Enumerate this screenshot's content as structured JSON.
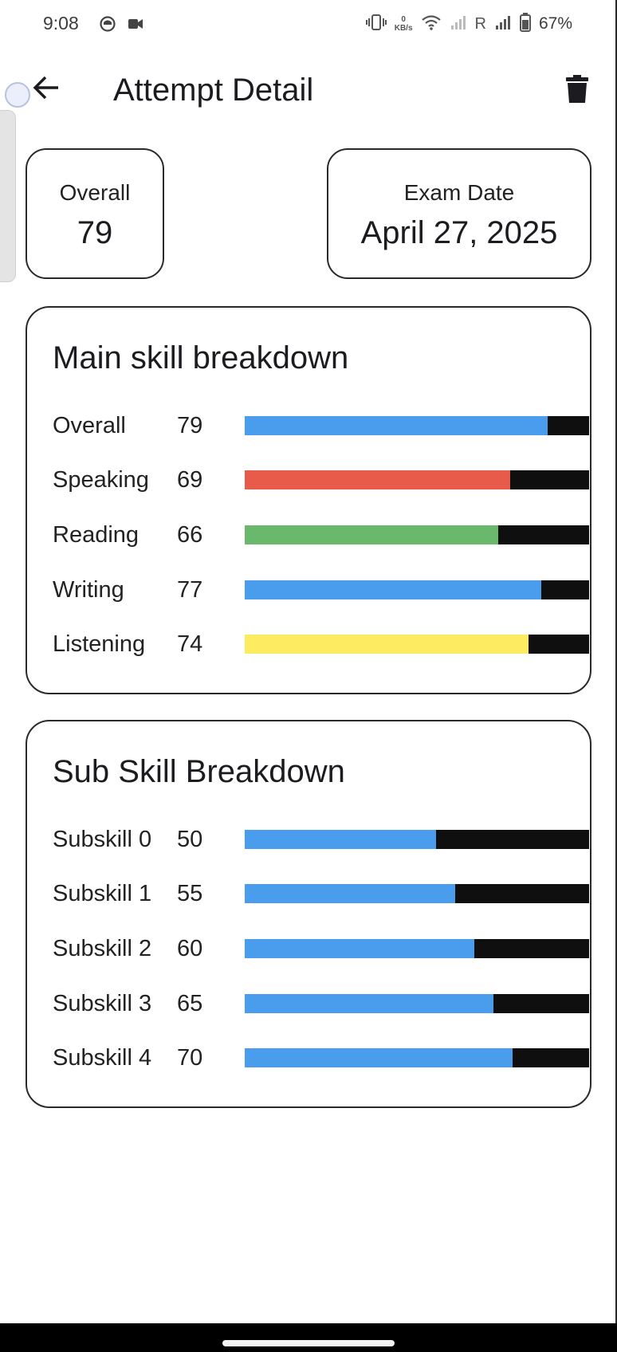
{
  "status_bar": {
    "time": "9:08",
    "net_speed_value": "0",
    "net_speed_unit": "KB/s",
    "carrier_label": "R",
    "battery_percent": "67%"
  },
  "app_bar": {
    "title": "Attempt Detail",
    "back_icon": "arrow-left-icon",
    "delete_icon": "trash-icon"
  },
  "summary": {
    "overall_label": "Overall",
    "overall_value": "79",
    "exam_date_label": "Exam Date",
    "exam_date_value": "April 27, 2025"
  },
  "main_skills": {
    "title": "Main skill breakdown",
    "rows": [
      {
        "name": "Overall",
        "score": "79",
        "fill_percent": 88,
        "color": "#4a9ded"
      },
      {
        "name": "Speaking",
        "score": "69",
        "fill_percent": 77,
        "color": "#e85a4a"
      },
      {
        "name": "Reading",
        "score": "66",
        "fill_percent": 73.5,
        "color": "#6ab86c"
      },
      {
        "name": "Writing",
        "score": "77",
        "fill_percent": 86,
        "color": "#4a9ded"
      },
      {
        "name": "Listening",
        "score": "74",
        "fill_percent": 82.5,
        "color": "#fcec62"
      }
    ]
  },
  "sub_skills": {
    "title": "Sub Skill Breakdown",
    "rows": [
      {
        "name": "Subskill 0",
        "score": "50",
        "fill_percent": 55.5,
        "color": "#4a9ded"
      },
      {
        "name": "Subskill 1",
        "score": "55",
        "fill_percent": 61,
        "color": "#4a9ded"
      },
      {
        "name": "Subskill 2",
        "score": "60",
        "fill_percent": 66.7,
        "color": "#4a9ded"
      },
      {
        "name": "Subskill 3",
        "score": "65",
        "fill_percent": 72.2,
        "color": "#4a9ded"
      },
      {
        "name": "Subskill 4",
        "score": "70",
        "fill_percent": 77.8,
        "color": "#4a9ded"
      }
    ]
  },
  "colors": {
    "bar_track": "#0f0f0f",
    "card_border": "#2a2a2a"
  }
}
